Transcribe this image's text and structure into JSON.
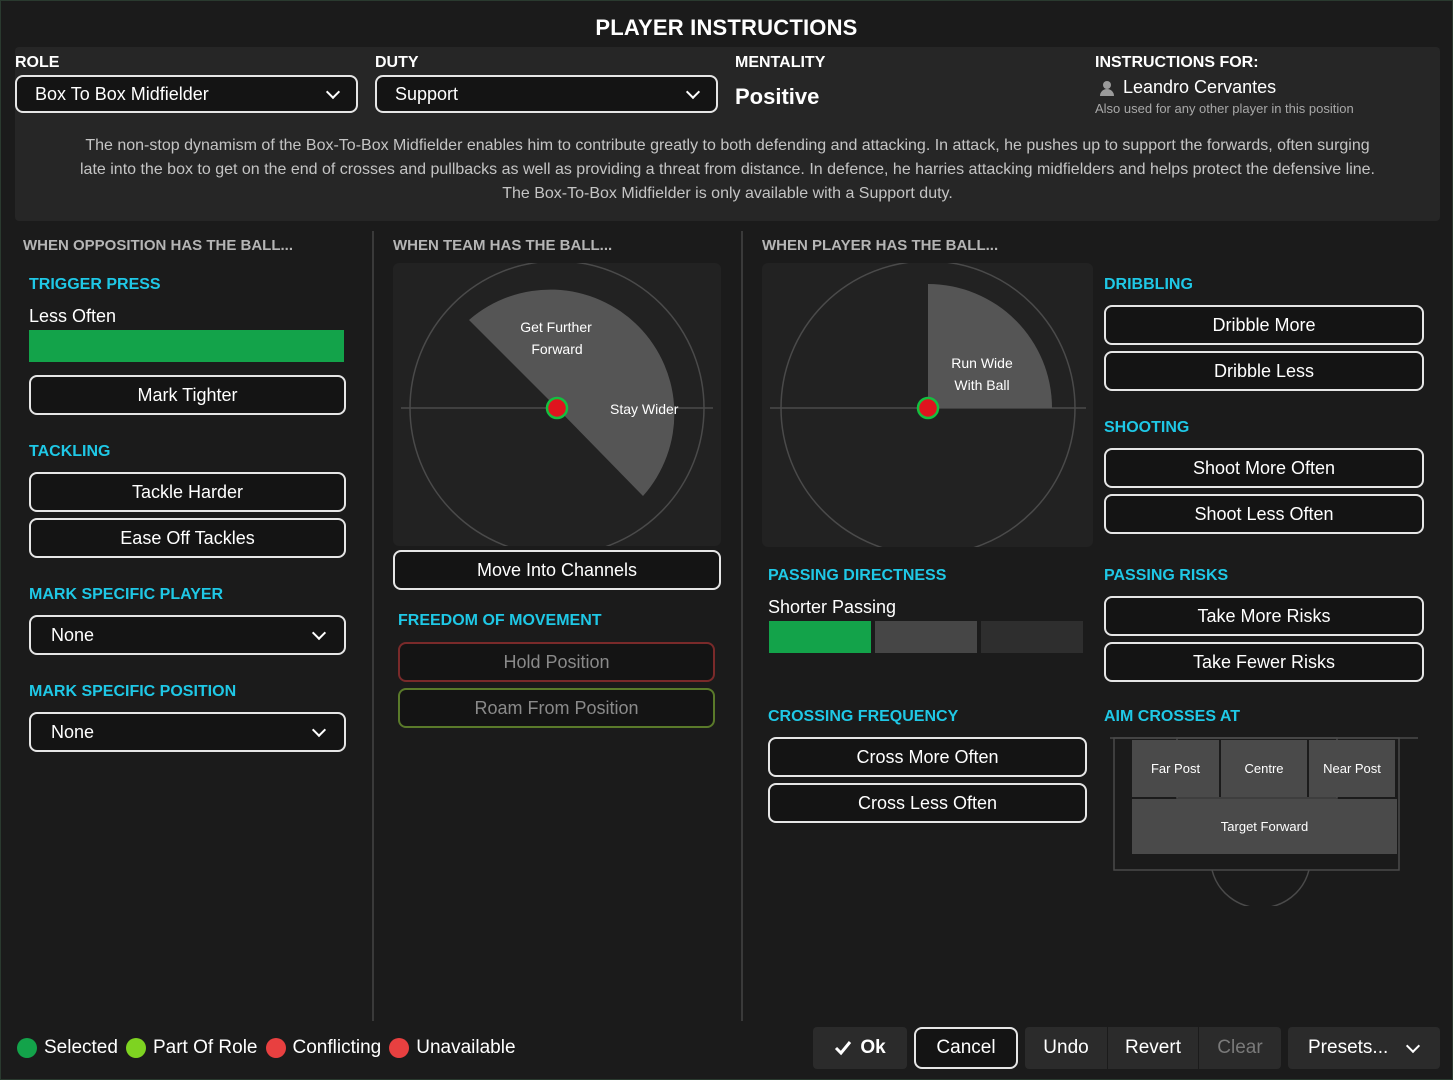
{
  "title": "PLAYER INSTRUCTIONS",
  "role": {
    "label": "ROLE",
    "value": "Box To Box Midfielder"
  },
  "duty": {
    "label": "DUTY",
    "value": "Support"
  },
  "mentality": {
    "label": "MENTALITY",
    "value": "Positive"
  },
  "instructions_for": {
    "label": "INSTRUCTIONS FOR:",
    "player": "Leandro Cervantes",
    "note": "Also used for any other player in this position"
  },
  "description": [
    "The non-stop dynamism of the Box-To-Box Midfielder enables him to contribute greatly to both defending and attacking. In attack, he pushes up to support the forwards, often surging",
    "late into the box to get on the end of crosses and pullbacks as well as providing a threat from distance. In defence, he harries attacking midfielders and helps protect the defensive line.",
    "The Box-To-Box Midfielder is only available with a Support duty."
  ],
  "opposition": {
    "heading": "WHEN OPPOSITION HAS THE BALL...",
    "trigger_press": {
      "heading": "TRIGGER PRESS",
      "value": "Less Often",
      "level": 1.0
    },
    "mark_tighter": "Mark Tighter",
    "tackling": {
      "heading": "TACKLING",
      "harder": "Tackle Harder",
      "ease": "Ease Off Tackles"
    },
    "mark_player": {
      "heading": "MARK SPECIFIC PLAYER",
      "value": "None"
    },
    "mark_position": {
      "heading": "MARK SPECIFIC POSITION",
      "value": "None"
    }
  },
  "team": {
    "heading": "WHEN TEAM HAS THE BALL...",
    "pitch_forward": "Get Further",
    "pitch_forward2": "Forward",
    "pitch_wide": "Stay Wider",
    "channels": "Move Into Channels",
    "freedom": {
      "heading": "FREEDOM OF MOVEMENT",
      "hold": "Hold Position",
      "roam": "Roam From Position"
    }
  },
  "player_ball": {
    "heading": "WHEN PLAYER HAS THE BALL...",
    "pitch_run1": "Run Wide",
    "pitch_run2": "With Ball",
    "passing_directness": {
      "heading": "PASSING DIRECTNESS",
      "value": "Shorter Passing",
      "segments_selected": 1,
      "segments_total": 3
    },
    "crossing": {
      "heading": "CROSSING FREQUENCY",
      "more": "Cross More Often",
      "less": "Cross Less Often"
    },
    "dribbling": {
      "heading": "DRIBBLING",
      "more": "Dribble More",
      "less": "Dribble Less"
    },
    "shooting": {
      "heading": "SHOOTING",
      "more": "Shoot More Often",
      "less": "Shoot Less Often"
    },
    "passing_risks": {
      "heading": "PASSING RISKS",
      "more": "Take More Risks",
      "fewer": "Take Fewer Risks"
    },
    "aim_crosses": {
      "heading": "AIM CROSSES AT",
      "far": "Far Post",
      "centre": "Centre",
      "near": "Near Post",
      "target": "Target Forward"
    }
  },
  "legend": {
    "selected": "Selected",
    "part_of_role": "Part Of Role",
    "conflicting": "Conflicting",
    "unavailable": "Unavailable"
  },
  "footer": {
    "ok": "Ok",
    "cancel": "Cancel",
    "undo": "Undo",
    "revert": "Revert",
    "clear": "Clear",
    "presets": "Presets..."
  },
  "colors": {
    "accent": "#1fc8e6",
    "selected": "#13a34a",
    "part_of_role": "#7ed321",
    "conflicting": "#e84040",
    "unavailable": "#e84040"
  }
}
